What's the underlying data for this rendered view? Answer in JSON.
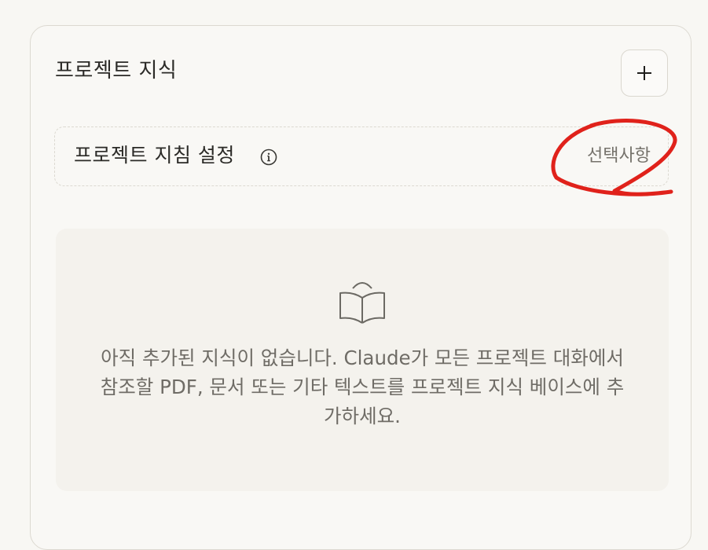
{
  "knowledge": {
    "title": "프로젝트 지식",
    "add_button_icon": "plus-icon",
    "instructions": {
      "label": "프로젝트 지침 설정",
      "info_icon": "info-icon",
      "optional_label": "선택사항"
    },
    "empty_state": {
      "icon": "book-icon",
      "message": "아직 추가된 지식이 없습니다. Claude가 모든 프로젝트 대화에서 참조할 PDF, 문서 또는 기타 텍스트를 프로젝트 지식 베이스에 추가하세요."
    }
  },
  "annotation": {
    "color": "#e0221b"
  }
}
